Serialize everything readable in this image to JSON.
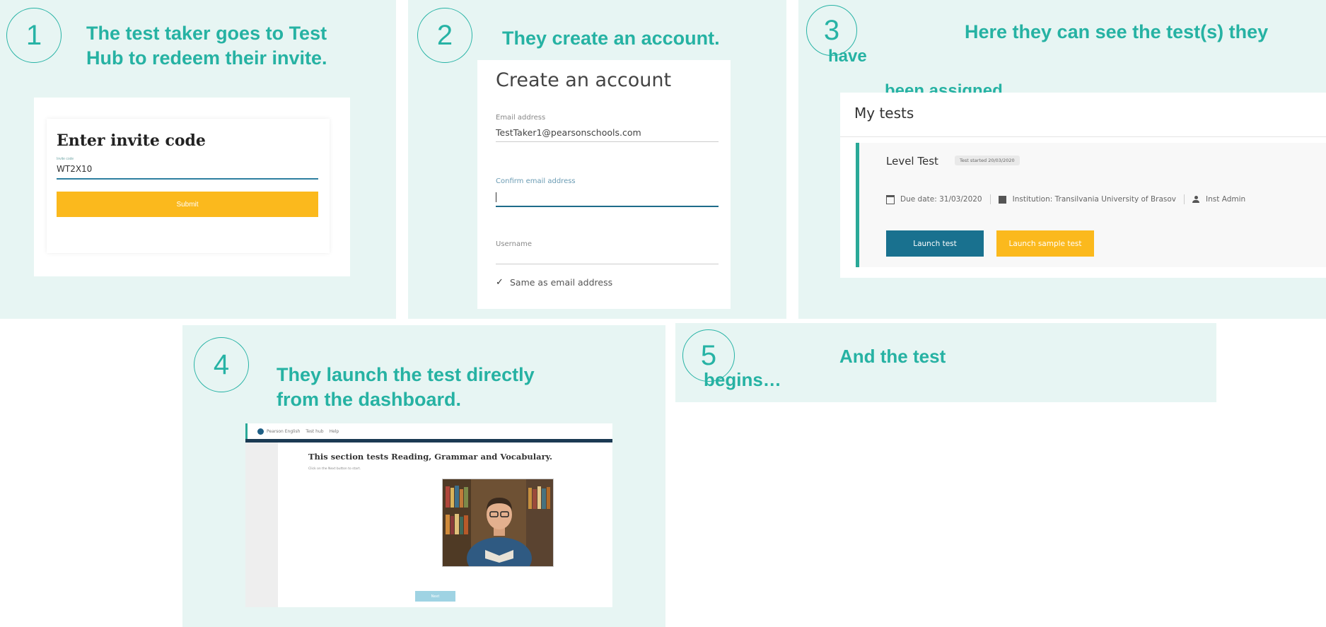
{
  "steps": [
    {
      "number": "1",
      "caption_line1": "The test taker goes to Test",
      "caption_line2": "Hub to redeem their invite."
    },
    {
      "number": "2",
      "caption": "They create an account."
    },
    {
      "number": "3",
      "caption_line1": "Here they can see the test(s) they",
      "caption_line2": "have",
      "caption_line3": "been assigned."
    },
    {
      "number": "4",
      "caption_line1": "They launch the test directly",
      "caption_line2": "from the dashboard."
    },
    {
      "number": "5",
      "caption_line1": "And the test",
      "caption_line2": "begins…"
    }
  ],
  "invite": {
    "title": "Enter invite code",
    "field_label": "Invite code",
    "field_value": "WT2X10",
    "submit_label": "Submit"
  },
  "account": {
    "title": "Create an account",
    "email_label": "Email address",
    "email_value": "TestTaker1@pearsonschools.com",
    "confirm_label": "Confirm email address",
    "username_label": "Username",
    "same_as_email_label": "Same as email address",
    "checkbox_mark": "✓"
  },
  "my_tests": {
    "title": "My tests",
    "test_name": "Level Test",
    "status_badge": "Test started 20/03/2020",
    "due_date": "Due date: 31/03/2020",
    "institution": "Institution: Transilvania University of Brasov",
    "admin": "Inst Admin",
    "launch_label": "Launch test",
    "launch_sample_label": "Launch sample test"
  },
  "test_screen": {
    "brand": "Pearson English",
    "nav_1": "Test hub",
    "nav_2": "Help",
    "section_heading": "This section tests Reading, Grammar and Vocabulary.",
    "instruction": "Click on the Next button to start.",
    "next_label": "Next"
  },
  "colors": {
    "panel_bg": "#e7f5f3",
    "accent": "#26b2a3",
    "submit_yellow": "#fbb91d",
    "launch_blue": "#19718f",
    "sample_yellow": "#fbb91d"
  }
}
